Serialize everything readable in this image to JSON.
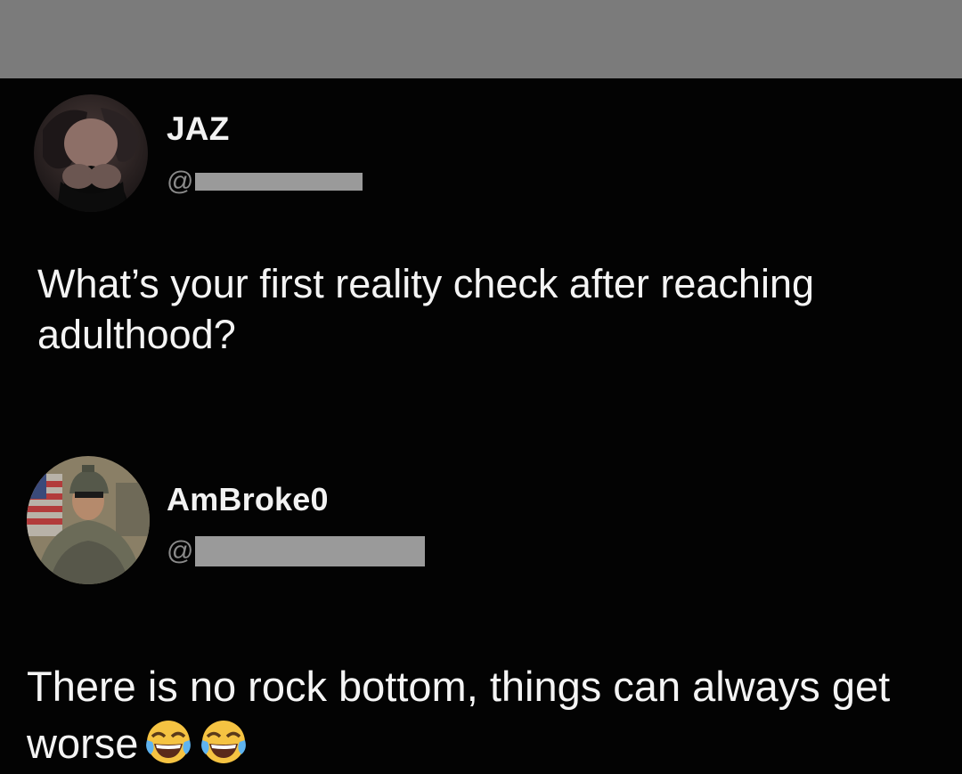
{
  "header_bar": {
    "color": "#7b7b7b"
  },
  "posts": [
    {
      "display_name": "JAZ",
      "handle_prefix": "@",
      "text": "What’s your first reality check after reaching adulthood?"
    },
    {
      "display_name": "AmBroke0",
      "handle_prefix": "@",
      "text": "There is no rock bottom, things can always get worse",
      "emojis": [
        "face-with-tears-of-joy-icon",
        "face-with-tears-of-joy-icon"
      ]
    }
  ]
}
